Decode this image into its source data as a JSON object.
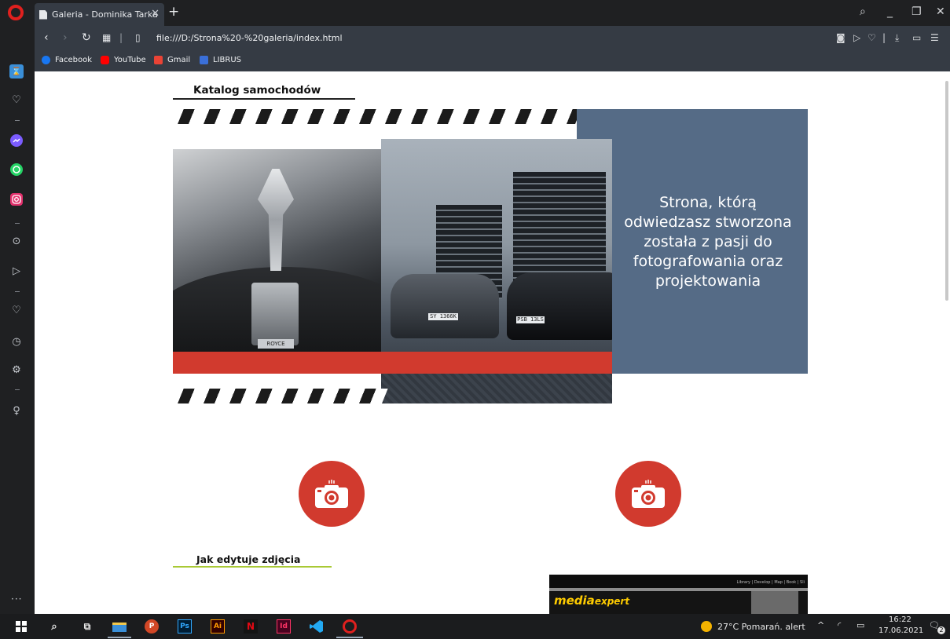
{
  "browser": {
    "tab_title": "Galeria - Dominika Tarka",
    "tab_close": "✕",
    "new_tab": "+",
    "url": "file:///D:/Strona%20-%20galeria/index.html",
    "window_controls": [
      "search-icon",
      "minimize-icon",
      "restore-icon",
      "close-icon"
    ],
    "bookmarks": [
      {
        "label": "Facebook",
        "color": "#1877f2"
      },
      {
        "label": "YouTube",
        "color": "#ff0000"
      },
      {
        "label": "Gmail",
        "color": "#ea4335"
      },
      {
        "label": "LIBRUS",
        "color": "#3a6fd8"
      }
    ],
    "sidebar_icons": [
      "workspace-icon",
      "heart-icon",
      "messenger-icon",
      "whatsapp-icon",
      "instagram-icon",
      "player-icon",
      "send-icon",
      "heart-icon",
      "history-icon",
      "settings-icon",
      "lightbulb-icon"
    ]
  },
  "page": {
    "title": "Katalog samochodów",
    "panel_text": "Strona, którą odwiedzasz stworzona została z pasji do fotografowania oraz projektowania",
    "subtitle": "Jak edytuje zdjęcia",
    "photo_left_badge": "ROYCE",
    "plates": [
      "SY 1366K",
      "PSB 13LS"
    ],
    "preview": {
      "menu": "Library  |  Develop  |  Map  |  Book  |  Sli",
      "logo_main": "media",
      "logo_sub": "expert"
    },
    "colors": {
      "accent_red": "#d13a2e",
      "panel_blue": "#556b86",
      "underline_green": "#a9c935"
    }
  },
  "taskbar": {
    "apps": [
      "windows-start",
      "search",
      "task-view",
      "file-explorer",
      "powerpoint",
      "photoshop",
      "illustrator",
      "netflix",
      "indesign",
      "vscode",
      "opera"
    ],
    "ps_label": "Ps",
    "ai_label": "Ai",
    "netflix_label": "N",
    "id_label": "Id",
    "ppt_label": "P",
    "weather": "27°C  Pomarań. alert",
    "time": "16:22",
    "date": "17.06.2021",
    "notifications": "2"
  }
}
